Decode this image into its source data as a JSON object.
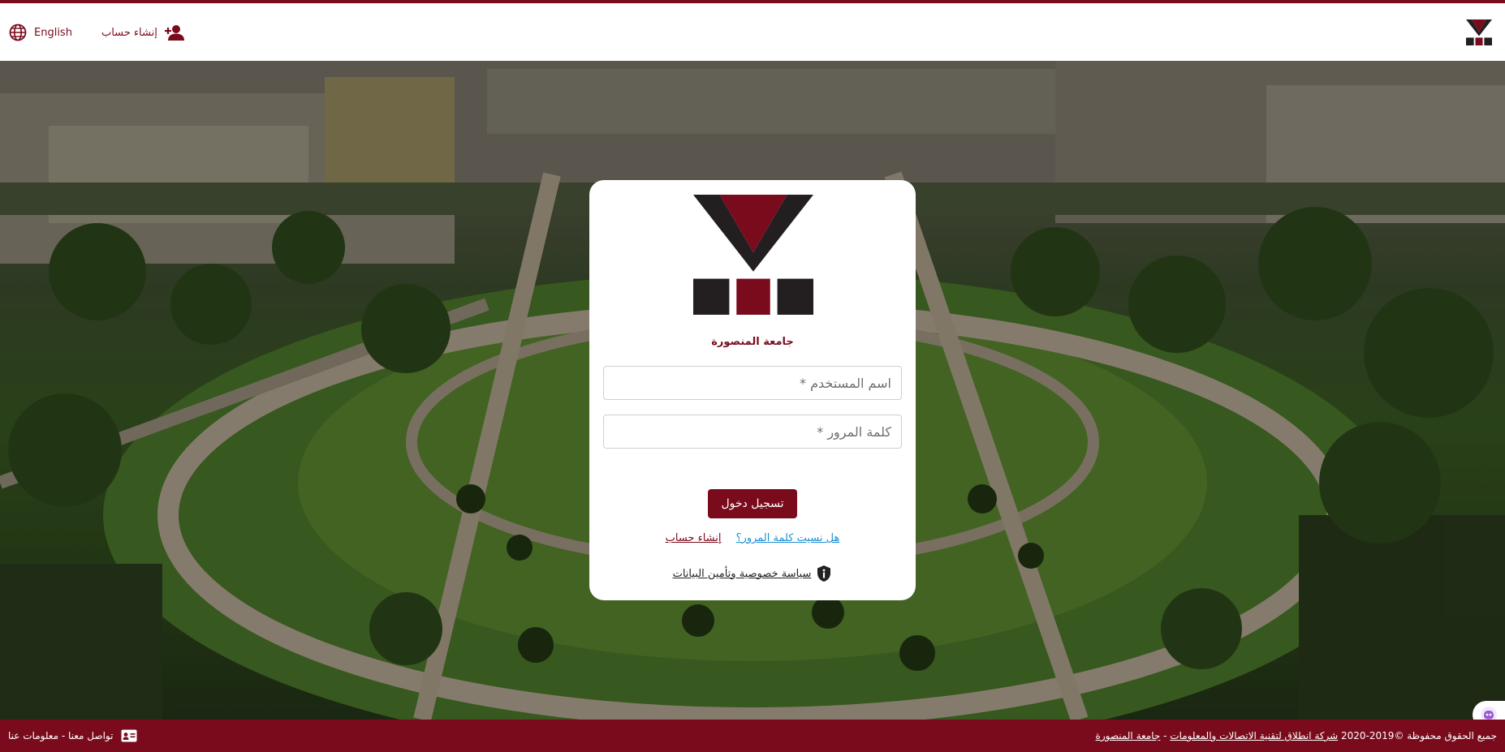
{
  "header": {
    "language_label": "English",
    "signup_label": "إنشاء حساب",
    "language_icon": "globe-icon",
    "signup_icon": "add-user-icon"
  },
  "login_card": {
    "university_name": "جامعة المنصورة",
    "username_placeholder": "اسم المستخدم *",
    "password_placeholder": "كلمة المرور *",
    "login_button": "تسجيل دخول",
    "forgot_password_link": "هل نسيت كلمة المرور؟",
    "create_account_link": "إنشاء حساب",
    "privacy_link": "سياسة خصوصية وتأمين البيانات",
    "privacy_icon": "shield-info-icon"
  },
  "footer": {
    "copyright_text": "جميع الحقوق محفوظة ©2019-2020",
    "company_link": "شركة انطلاق لتقنية الاتصالات والمعلومات",
    "separator": " - ",
    "university_link": "جامعة المنصورة",
    "contact_text": "تواصل معنا - معلومات عنا",
    "contact_icon": "contact-card-icon"
  },
  "colors": {
    "brand_maroon": "#7a0b1c",
    "link_blue": "#1d8fd3",
    "logo_dark": "#231f20"
  }
}
